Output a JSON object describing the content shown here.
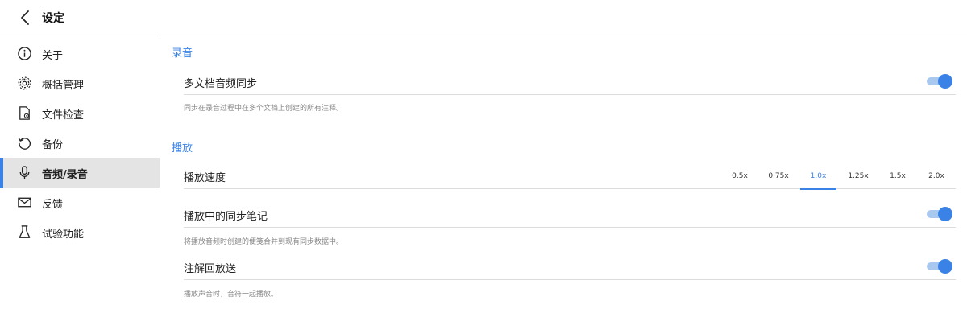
{
  "header": {
    "title": "设定",
    "back_icon": "chevron-left-icon"
  },
  "sidebar": {
    "items": [
      {
        "label": "关于",
        "icon": "info-circle-icon",
        "active": false
      },
      {
        "label": "概括管理",
        "icon": "gear-icon",
        "active": false
      },
      {
        "label": "文件检查",
        "icon": "document-gear-icon",
        "active": false
      },
      {
        "label": "备份",
        "icon": "history-icon",
        "active": false
      },
      {
        "label": "音频/录音",
        "icon": "microphone-icon",
        "active": true
      },
      {
        "label": "反馈",
        "icon": "mail-icon",
        "active": false
      },
      {
        "label": "试验功能",
        "icon": "flask-icon",
        "active": false
      }
    ]
  },
  "main": {
    "recording": {
      "title": "录音",
      "sync": {
        "label": "多文档音频同步",
        "on": true,
        "desc": "同步在录音过程中在多个文档上创建的所有注释。"
      }
    },
    "playback": {
      "title": "播放",
      "speed": {
        "label": "播放速度",
        "options": [
          "0.5x",
          "0.75x",
          "1.0x",
          "1.25x",
          "1.5x",
          "2.0x"
        ],
        "selected": "1.0x"
      },
      "sync_notes": {
        "label": "播放中的同步笔记",
        "on": true,
        "desc": "将播放音频时创建的便笺合并到现有同步数据中。"
      },
      "annotation": {
        "label": "注解回放送",
        "on": true,
        "desc": "播放声音时，音符一起播放。"
      }
    }
  },
  "colors": {
    "accent": "#3b82e6",
    "toggle_track": "#a9c8f0",
    "active_bg": "#e4e4e4"
  }
}
